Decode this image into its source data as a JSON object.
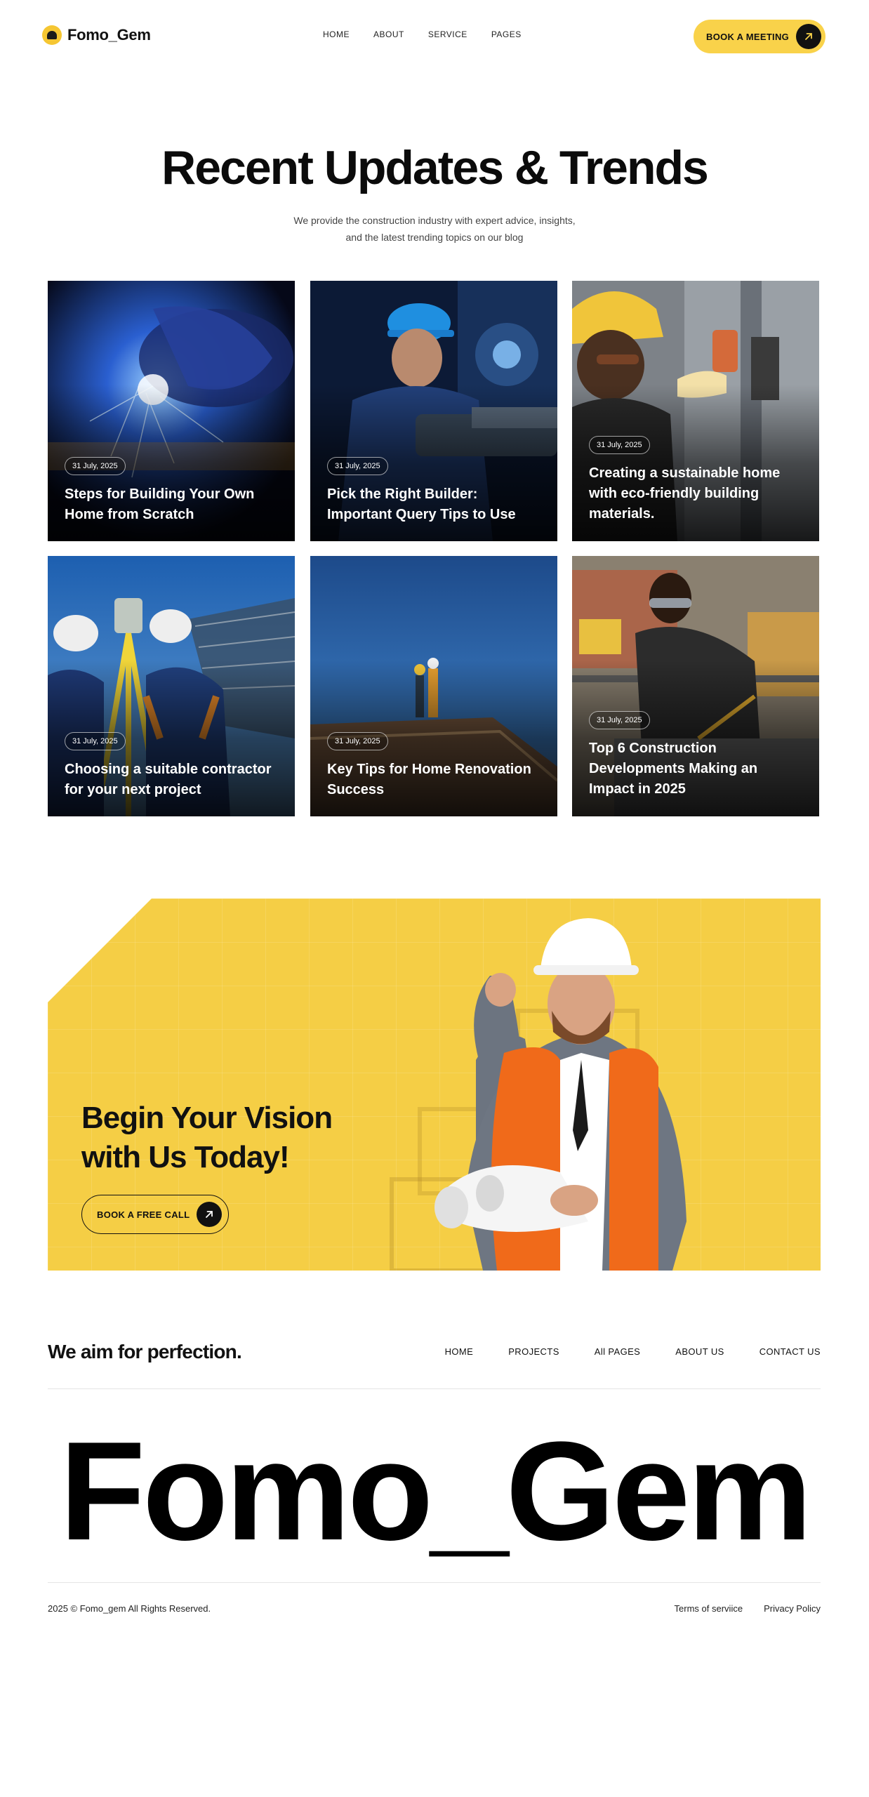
{
  "nav": {
    "brand": "Fomo_Gem",
    "items": [
      "HOME",
      "ABOUT",
      "SERVICE",
      "PAGES"
    ],
    "cta_label": "BOOK A MEETING"
  },
  "hero": {
    "title": "Recent Updates & Trends",
    "subtitle_line1": "We provide the construction industry with expert advice, insights,",
    "subtitle_line2": "and the latest trending topics on our blog"
  },
  "posts": [
    {
      "date": "31 July, 2025",
      "title": "Steps for Building Your Own Home from Scratch"
    },
    {
      "date": "31 July, 2025",
      "title": "Pick the Right Builder: Important Query Tips to Use"
    },
    {
      "date": "31 July, 2025",
      "title": "Creating a sustainable home with eco-friendly building materials."
    },
    {
      "date": "31 July, 2025",
      "title": "Choosing a suitable contractor for your next project"
    },
    {
      "date": "31 July, 2025",
      "title": "Key Tips for Home Renovation Success"
    },
    {
      "date": "31 July, 2025",
      "title": "Top 6 Construction Developments Making an Impact in 2025"
    }
  ],
  "banner": {
    "title": "Begin Your Vision with Us Today!",
    "cta_label": "BOOK A FREE CALL"
  },
  "footer": {
    "slogan": "We aim for perfection.",
    "menu": [
      "HOME",
      "PROJECTS",
      "All PAGES",
      "ABOUT US",
      "CONTACT US"
    ],
    "brand_large": "Fomo_Gem",
    "copyright": "2025 © Fomo_gem All Rights Reserved.",
    "terms": "Terms of serviice",
    "privacy": "Privacy Policy"
  },
  "colors": {
    "accent": "#F5CE45",
    "button_yellow": "#F9D24A",
    "text_dark": "#111111"
  }
}
